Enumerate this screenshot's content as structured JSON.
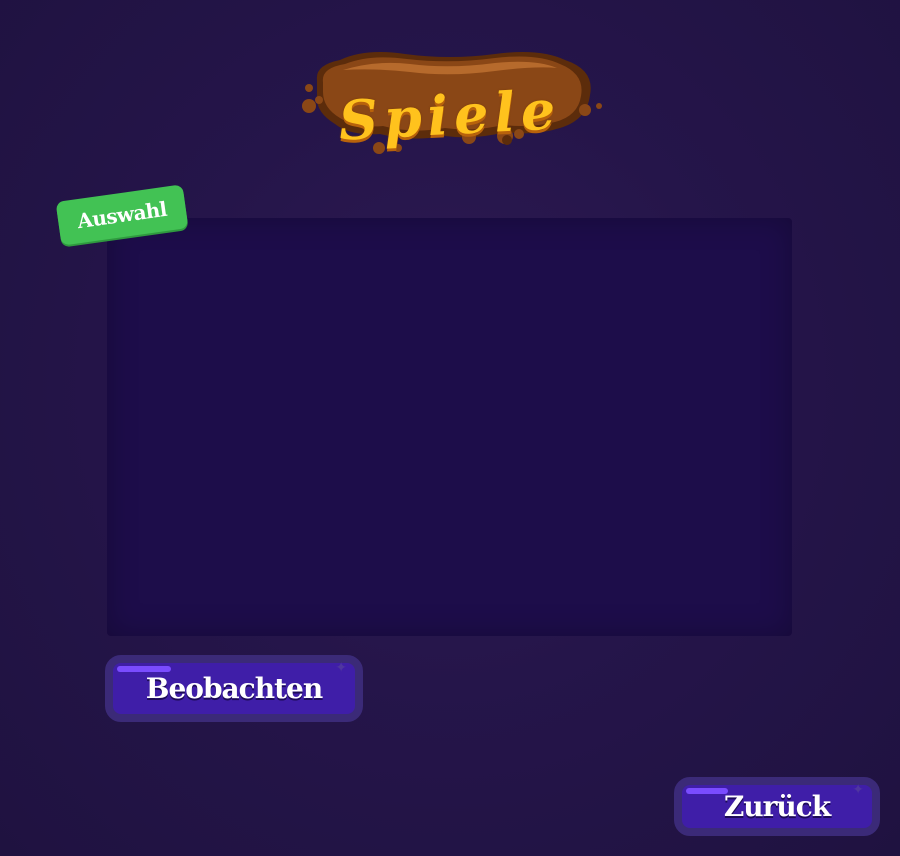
{
  "header": {
    "title": "Spiele"
  },
  "selection_panel": {
    "tag_label": "Auswahl"
  },
  "buttons": {
    "watch_label": "Beobachten",
    "back_label": "Zurück"
  },
  "colors": {
    "background": "#25154a",
    "panel": "#1d0d4a",
    "tag": "#42c254",
    "button": "#3f1ea8",
    "button_border": "#3b2a78",
    "title_text": "#ffc21d",
    "title_banner": "#8a4716"
  }
}
